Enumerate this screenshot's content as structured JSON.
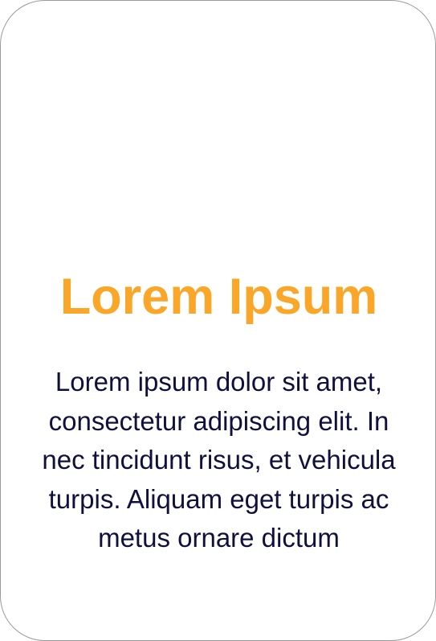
{
  "card": {
    "title": "Lorem Ipsum",
    "body": "Lorem ipsum dolor sit amet, consectetur adipiscing elit. In nec tincidunt risus, et vehicula turpis. Aliquam eget turpis ac metus ornare dictum"
  },
  "colors": {
    "title": "#FAA629",
    "body": "#10103F",
    "border": "#9A9A9A",
    "background": "#FFFFFF"
  }
}
